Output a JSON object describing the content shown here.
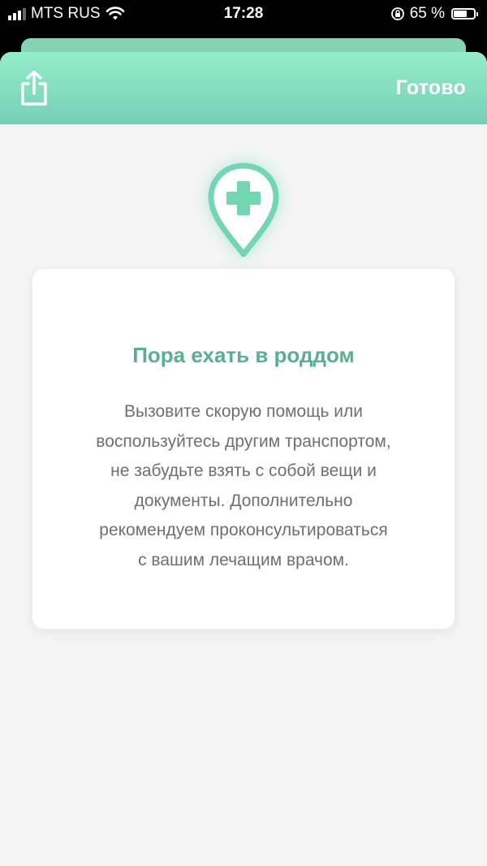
{
  "status_bar": {
    "carrier": "MTS RUS",
    "time": "17:28",
    "battery_percent": "65 %",
    "battery_level": 0.65
  },
  "header": {
    "done_label": "Готово",
    "accent_color": "#7fdbb9"
  },
  "card": {
    "title": "Пора ехать в роддом",
    "body_lines": [
      "Вызовите скорую помощь или",
      "воспользуйтесь другим транспортом,",
      "не забудьте взять с собой вещи и",
      "документы. Дополнительно",
      "рекомендуем проконсультироваться",
      "с вашим лечащим врачом."
    ],
    "title_color": "#5aae93",
    "icon": "hospital-location-pin-icon"
  }
}
